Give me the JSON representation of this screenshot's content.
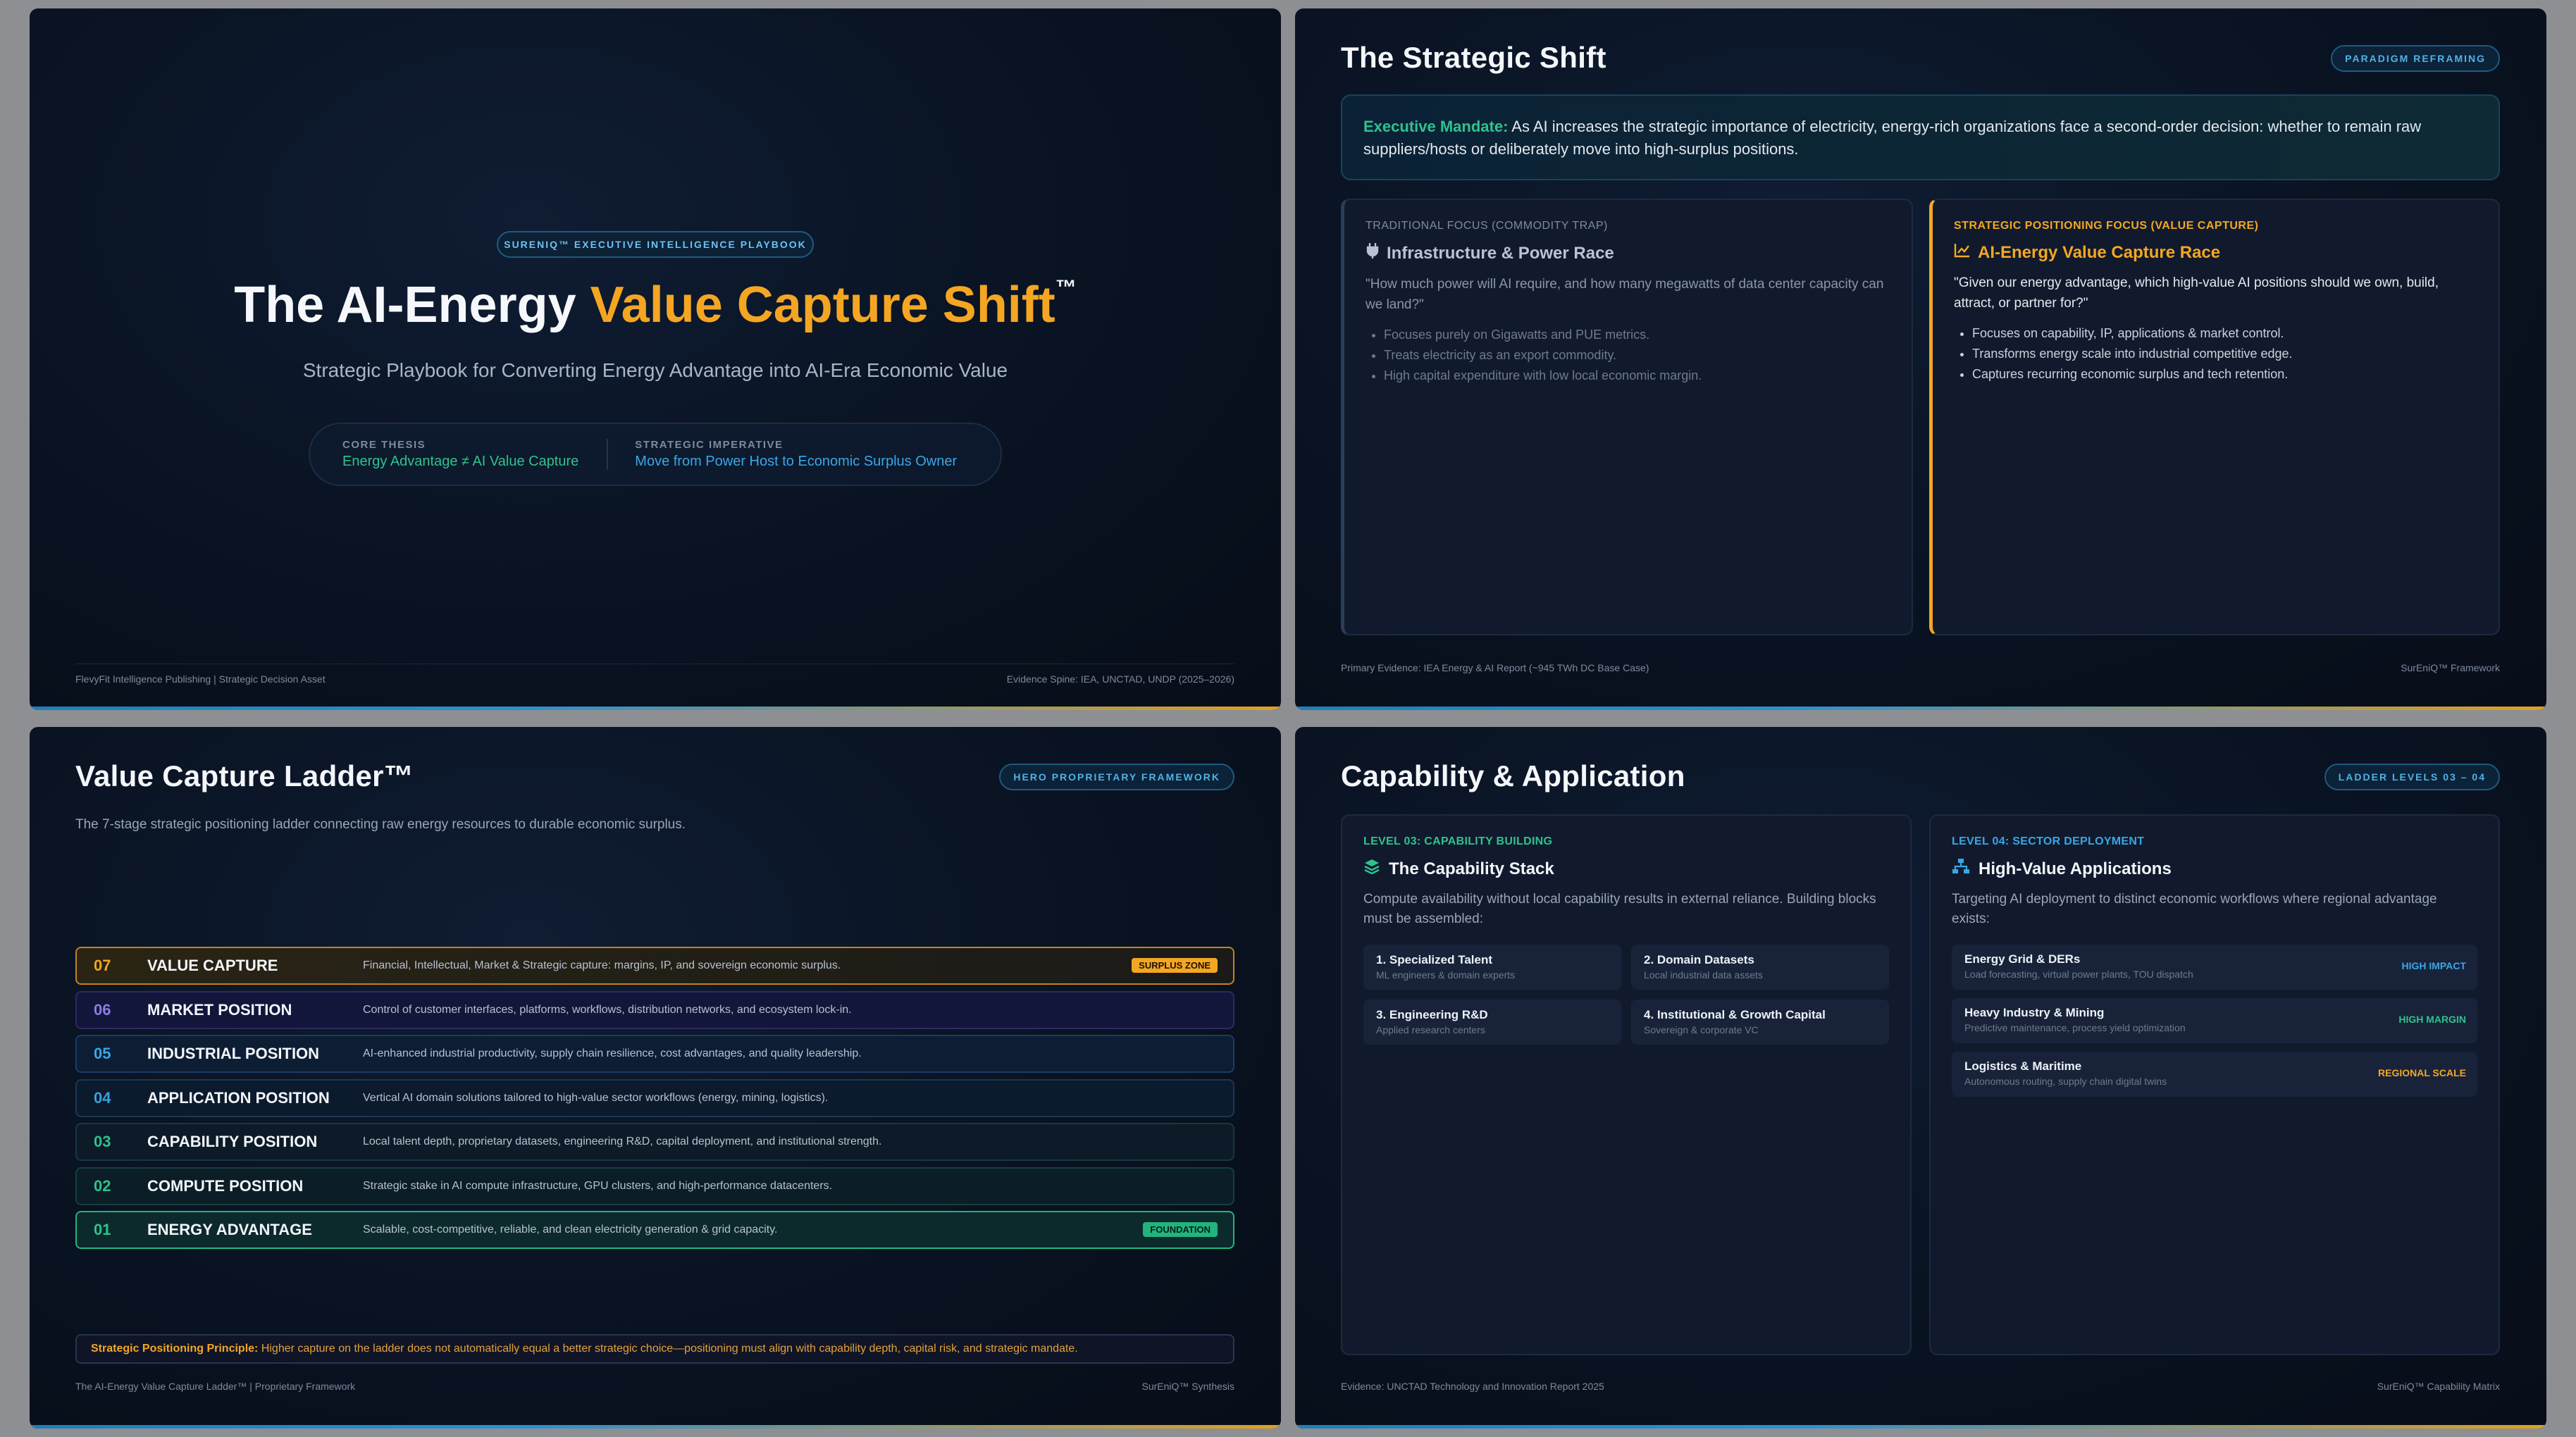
{
  "slide1": {
    "eyebrow": "SURENIQ™ EXECUTIVE INTELLIGENCE PLAYBOOK",
    "title_part1": "The AI-Energy ",
    "title_accent": "Value Capture Shift",
    "title_tm": "™",
    "subtitle": "Strategic Playbook for Converting Energy Advantage into AI-Era Economic Value",
    "core_thesis_label": "CORE THESIS",
    "core_thesis_value": "Energy Advantage ≠ AI Value Capture",
    "imperative_label": "STRATEGIC IMPERATIVE",
    "imperative_value": "Move from Power Host to Economic Surplus Owner",
    "footer_left": "FlevyFit Intelligence Publishing | Strategic Decision Asset",
    "footer_right": "Evidence Spine: IEA, UNCTAD, UNDP (2025–2026)"
  },
  "slide2": {
    "title": "The Strategic Shift",
    "tag": "PARADIGM REFRAMING",
    "mandate_label": "Executive Mandate:",
    "mandate_text": " As AI increases the strategic importance of electricity, energy-rich organizations face a second-order decision: whether to remain raw suppliers/hosts or deliberately move into high-surplus positions.",
    "left": {
      "kicker": "TRADITIONAL FOCUS (COMMODITY TRAP)",
      "heading": "Infrastructure & Power Race",
      "quote": "\"How much power will AI require, and how many megawatts of data center capacity can we land?\"",
      "bullets": [
        "Focuses purely on Gigawatts and PUE metrics.",
        "Treats electricity as an export commodity.",
        "High capital expenditure with low local economic margin."
      ]
    },
    "right": {
      "kicker": "STRATEGIC POSITIONING FOCUS (VALUE CAPTURE)",
      "heading": "AI-Energy Value Capture Race",
      "quote": "\"Given our energy advantage, which high-value AI positions should we own, build, attract, or partner for?\"",
      "bullets": [
        "Focuses on capability, IP, applications & market control.",
        "Transforms energy scale into industrial competitive edge.",
        "Captures recurring economic surplus and tech retention."
      ]
    },
    "footer_left": "Primary Evidence: IEA Energy & AI Report (~945 TWh DC Base Case)",
    "footer_right": "SurEniQ™ Framework"
  },
  "slide3": {
    "title": "Value Capture Ladder™",
    "tag": "HERO PROPRIETARY FRAMEWORK",
    "description": "The 7-stage strategic positioning ladder connecting raw energy resources to durable economic surplus.",
    "rungs": [
      {
        "num": "07",
        "name": "VALUE CAPTURE",
        "text": "Financial, Intellectual, Market & Strategic capture: margins, IP, and sovereign economic surplus.",
        "badge": "SURPLUS ZONE"
      },
      {
        "num": "06",
        "name": "MARKET POSITION",
        "text": "Control of customer interfaces, platforms, workflows, distribution networks, and ecosystem lock-in.",
        "badge": ""
      },
      {
        "num": "05",
        "name": "INDUSTRIAL POSITION",
        "text": "AI-enhanced industrial productivity, supply chain resilience, cost advantages, and quality leadership.",
        "badge": ""
      },
      {
        "num": "04",
        "name": "APPLICATION POSITION",
        "text": "Vertical AI domain solutions tailored to high-value sector workflows (energy, mining, logistics).",
        "badge": ""
      },
      {
        "num": "03",
        "name": "CAPABILITY POSITION",
        "text": "Local talent depth, proprietary datasets, engineering R&D, capital deployment, and institutional strength.",
        "badge": ""
      },
      {
        "num": "02",
        "name": "COMPUTE POSITION",
        "text": "Strategic stake in AI compute infrastructure, GPU clusters, and high-performance datacenters.",
        "badge": ""
      },
      {
        "num": "01",
        "name": "ENERGY ADVANTAGE",
        "text": "Scalable, cost-competitive, reliable, and clean electricity generation & grid capacity.",
        "badge": "FOUNDATION"
      }
    ],
    "principle_label": "Strategic Positioning Principle:",
    "principle_text": " Higher capture on the ladder does not automatically equal a better strategic choice—positioning must align with capability depth, capital risk, and strategic mandate.",
    "footer_left": "The AI-Energy Value Capture Ladder™ | Proprietary Framework",
    "footer_right": "SurEniQ™ Synthesis"
  },
  "slide4": {
    "title": "Capability & Application",
    "tag": "LADDER LEVELS 03 – 04",
    "left": {
      "kicker": "LEVEL 03: CAPABILITY BUILDING",
      "heading": "The Capability Stack",
      "desc": "Compute availability without local capability results in external reliance. Building blocks must be assembled:",
      "cells": [
        {
          "t": "1. Specialized Talent",
          "s": "ML engineers & domain experts"
        },
        {
          "t": "2. Domain Datasets",
          "s": "Local industrial data assets"
        },
        {
          "t": "3. Engineering R&D",
          "s": "Applied research centers"
        },
        {
          "t": "4. Institutional & Growth Capital",
          "s": "Sovereign & corporate VC"
        }
      ]
    },
    "right": {
      "kicker": "LEVEL 04: SECTOR DEPLOYMENT",
      "heading": "High-Value Applications",
      "desc": "Targeting AI deployment to distinct economic workflows where regional advantage exists:",
      "apps": [
        {
          "t": "Energy Grid & DERs",
          "s": "Load forecasting, virtual power plants, TOU dispatch",
          "level": "HIGH IMPACT",
          "color": "#38a7e8"
        },
        {
          "t": "Heavy Industry & Mining",
          "s": "Predictive maintenance, process yield optimization",
          "level": "HIGH MARGIN",
          "color": "#2fc28e"
        },
        {
          "t": "Logistics & Maritime",
          "s": "Autonomous routing, supply chain digital twins",
          "level": "REGIONAL SCALE",
          "color": "#f4a623"
        }
      ]
    },
    "footer_left": "Evidence: UNCTAD Technology and Innovation Report 2025",
    "footer_right": "SurEniQ™ Capability Matrix"
  }
}
